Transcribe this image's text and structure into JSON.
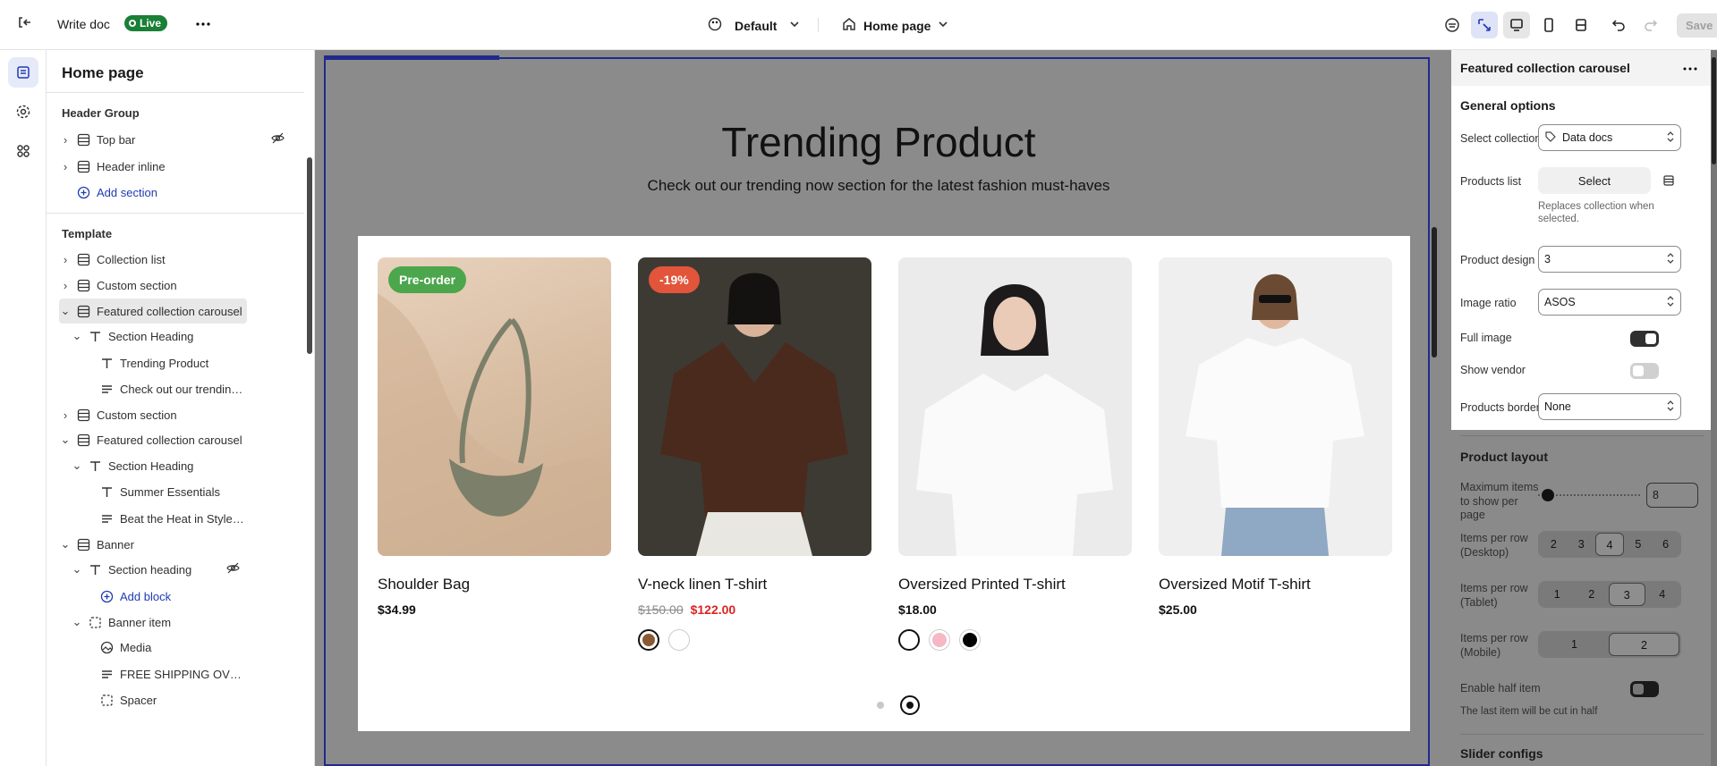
{
  "topbar": {
    "doc_title": "Write doc",
    "status": "Live",
    "theme": "Default",
    "page": "Home page",
    "save_label": "Save"
  },
  "sidebar": {
    "title": "Home page",
    "header_group_title": "Header Group",
    "header_items": [
      {
        "label": "Top bar"
      },
      {
        "label": "Header inline"
      }
    ],
    "add_section": "Add section",
    "template_title": "Template",
    "tree": [
      {
        "label": "Collection list"
      },
      {
        "label": "Custom section"
      },
      {
        "label": "Featured collection carousel"
      },
      {
        "label": "Section Heading"
      },
      {
        "label": "Trending Product"
      },
      {
        "label": "Check out our trending now s..."
      },
      {
        "label": "Custom section"
      },
      {
        "label": "Featured collection carousel"
      },
      {
        "label": "Section Heading"
      },
      {
        "label": "Summer Essentials"
      },
      {
        "label": "Beat the Heat in Style: It's tim..."
      },
      {
        "label": "Banner"
      },
      {
        "label": "Section heading"
      },
      {
        "label": "Add block"
      },
      {
        "label": "Banner item"
      },
      {
        "label": "Media"
      },
      {
        "label": "FREE SHIPPING OVER ORDER..."
      },
      {
        "label": "Spacer"
      }
    ]
  },
  "preview": {
    "title": "Trending Product",
    "subtitle": "Check out our trending now section for the latest fashion must-haves",
    "products": [
      {
        "name": "Shoulder Bag",
        "price": "$34.99",
        "badge": "Pre-order",
        "badge_color": "#4ca64c"
      },
      {
        "name": "V-neck linen T-shirt",
        "old_price": "$150.00",
        "price": "$122.00",
        "badge": "-19%",
        "badge_color": "#e2553a"
      },
      {
        "name": "Oversized Printed T-shirt",
        "price": "$18.00"
      },
      {
        "name": "Oversized Motif T-shirt",
        "price": "$25.00"
      }
    ],
    "swatch_colors": {
      "p2": [
        "#8a5a33",
        "#ffffff"
      ],
      "p3": [
        "#ffffff",
        "#f5b8c4",
        "#000000"
      ]
    }
  },
  "panel": {
    "title": "Featured collection carousel",
    "general_options": "General options",
    "select_collection_label": "Select collection",
    "select_collection_value": "Data docs",
    "products_list_label": "Products list",
    "products_list_button": "Select",
    "products_list_hint": "Replaces collection when selected.",
    "product_design_label": "Product design",
    "product_design_value": "3",
    "image_ratio_label": "Image ratio",
    "image_ratio_value": "ASOS",
    "full_image_label": "Full image",
    "show_vendor_label": "Show vendor",
    "products_border_label": "Products border",
    "products_border_value": "None",
    "product_layout": "Product layout",
    "max_items_label": "Maximum items to show per page",
    "max_items_value": "8",
    "ipr_desktop_label": "Items per row (Desktop)",
    "ipr_desktop": [
      "2",
      "3",
      "4",
      "5",
      "6"
    ],
    "ipr_tablet_label": "Items per row (Tablet)",
    "ipr_tablet": [
      "1",
      "2",
      "3",
      "4"
    ],
    "ipr_mobile_label": "Items per row (Mobile)",
    "ipr_mobile": [
      "1",
      "2"
    ],
    "half_item_label": "Enable half item",
    "half_item_hint": "The last item will be cut in half",
    "slider_configs": "Slider configs"
  },
  "colors": {
    "accent": "#1f3bb3",
    "live": "#1a7f37",
    "sale": "#dd2222"
  }
}
